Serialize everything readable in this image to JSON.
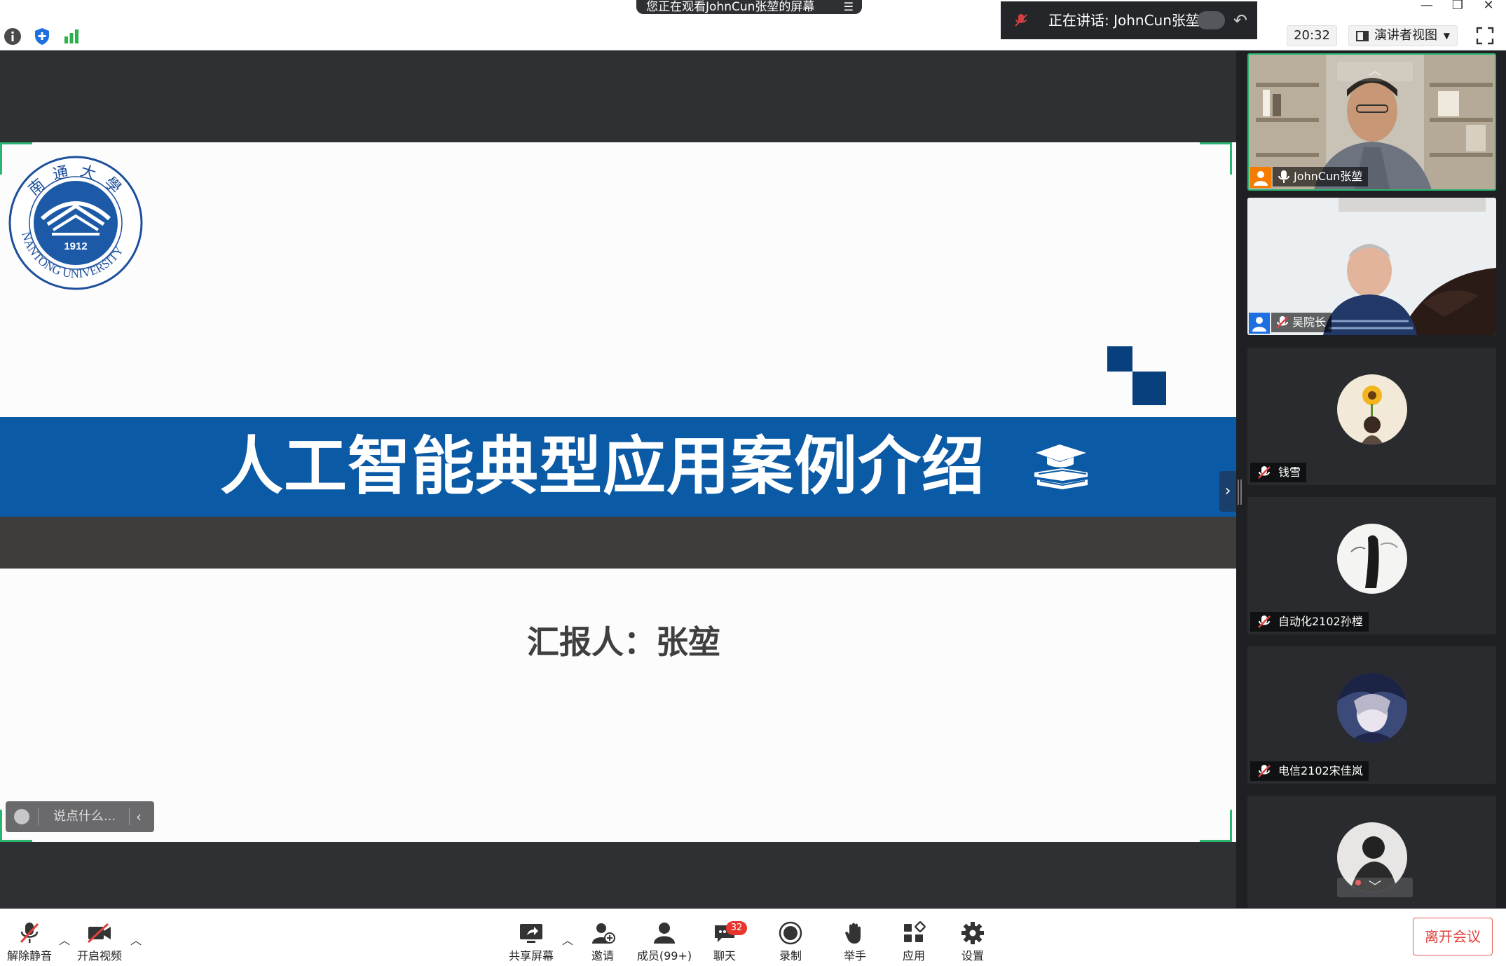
{
  "topbar": {
    "viewing_banner": "您正在观看JohnCun张堃的屏幕",
    "speaking_text": "正在讲话: JohnCun张堃;",
    "clock": "20:32",
    "presenter_view_label": "演讲者视图",
    "icons": [
      "info-icon",
      "security-shield-icon",
      "signal-bars-icon",
      "fullscreen-icon"
    ]
  },
  "slide": {
    "title": "人工智能典型应用案例介绍",
    "reporter": "汇报人：张堃",
    "logo_year": "1912",
    "logo_ring_text": "NANTONG UNIVERSITY",
    "logo_top_chars": "南通大學",
    "colors": {
      "title_band": "#0b5aa6",
      "dark_band": "#3f3c3c",
      "deco": "#08407e"
    }
  },
  "chat_input": {
    "placeholder": "说点什么..."
  },
  "participants": [
    {
      "name": "JohnCun张堃",
      "mic": "on",
      "badge": "host",
      "video": true,
      "active": true
    },
    {
      "name": "吴院长",
      "mic": "muted",
      "badge": "cohost",
      "video": true,
      "active": false
    },
    {
      "name": "钱雪",
      "mic": "muted",
      "video": false,
      "avatar": "sunflower"
    },
    {
      "name": "自动化2102孙樘",
      "mic": "muted",
      "video": false,
      "avatar": "ink-figure"
    },
    {
      "name": "电信2102宋佳岚",
      "mic": "muted",
      "video": false,
      "avatar": "anime"
    },
    {
      "name": "",
      "mic": "muted",
      "video": false,
      "avatar": "person-dark"
    }
  ],
  "toolbar": {
    "unmute": "解除静音",
    "start_video": "开启视频",
    "share_screen": "共享屏幕",
    "invite": "邀请",
    "members": "成员(99+)",
    "chat": "聊天",
    "chat_count": "32",
    "record": "录制",
    "raise_hand": "举手",
    "apps": "应用",
    "settings": "设置",
    "leave": "离开会议"
  }
}
